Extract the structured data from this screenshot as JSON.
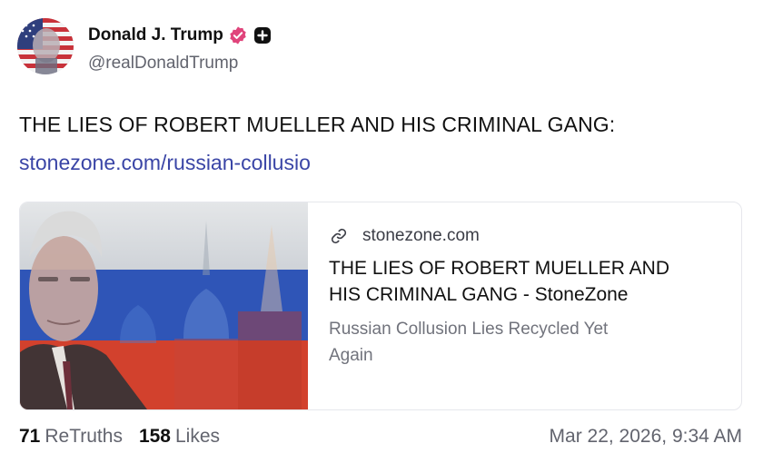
{
  "author": {
    "display_name": "Donald J. Trump",
    "handle": "@realDonaldTrump",
    "badges": [
      "verified-badge-icon",
      "plus-square-icon"
    ],
    "verified_color": "#e0447b"
  },
  "post": {
    "text": "THE LIES OF ROBERT MUELLER AND HIS CRIMINAL GANG:",
    "link": "stonezone.com/russian-collusio"
  },
  "card": {
    "image_icon": "portrait-over-flag-image",
    "domain": "stonezone.com",
    "title": "THE LIES OF ROBERT MUELLER AND HIS CRIMINAL GANG - StoneZone",
    "description": "Russian Collusion Lies Recycled Yet Again"
  },
  "stats": {
    "retruths_count": "71",
    "retruths_label": "ReTruths",
    "likes_count": "158",
    "likes_label": "Likes"
  },
  "timestamp": "Mar 22, 2026, 9:34 AM",
  "colors": {
    "link": "#3a45a6",
    "muted": "#62646e",
    "text": "#111111"
  }
}
